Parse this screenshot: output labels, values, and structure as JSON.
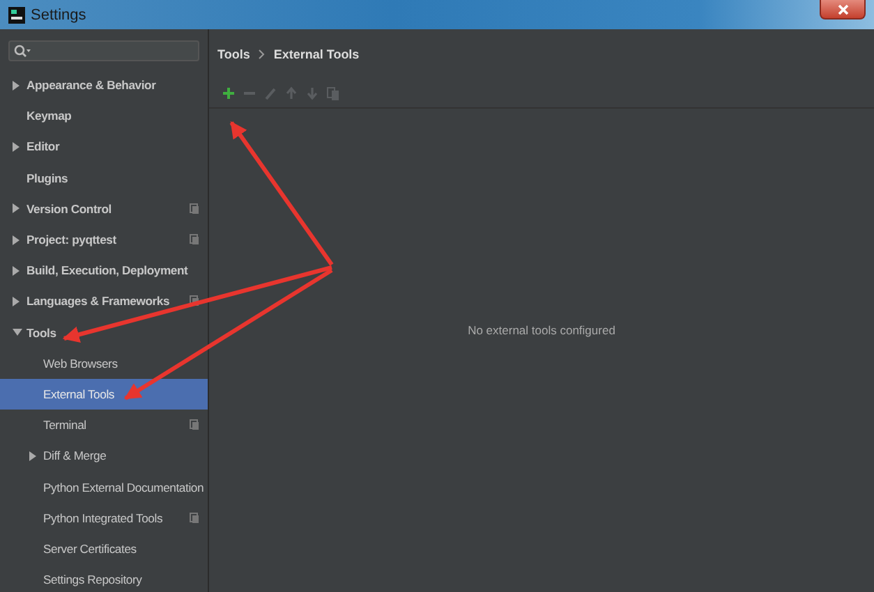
{
  "window": {
    "title": "Settings"
  },
  "breadcrumb": [
    "Tools",
    "External Tools"
  ],
  "tree": [
    {
      "label": "Appearance & Behavior",
      "kind": "group",
      "expanded": false,
      "selected": false,
      "project_icon": false
    },
    {
      "label": "Keymap",
      "kind": "leaf",
      "selected": false,
      "project_icon": false
    },
    {
      "label": "Editor",
      "kind": "group",
      "expanded": false,
      "selected": false,
      "project_icon": false
    },
    {
      "label": "Plugins",
      "kind": "leaf",
      "selected": false,
      "project_icon": false
    },
    {
      "label": "Version Control",
      "kind": "group",
      "expanded": false,
      "selected": false,
      "project_icon": true
    },
    {
      "label": "Project: pyqttest",
      "kind": "group",
      "expanded": false,
      "selected": false,
      "project_icon": true
    },
    {
      "label": "Build, Execution, Deployment",
      "kind": "group",
      "expanded": false,
      "selected": false,
      "project_icon": false
    },
    {
      "label": "Languages & Frameworks",
      "kind": "group",
      "expanded": false,
      "selected": false,
      "project_icon": true
    },
    {
      "label": "Tools",
      "kind": "group",
      "expanded": true,
      "selected": false,
      "project_icon": false,
      "children": [
        {
          "label": "Web Browsers",
          "kind": "leaf",
          "selected": false,
          "project_icon": false
        },
        {
          "label": "External Tools",
          "kind": "leaf",
          "selected": true,
          "project_icon": false
        },
        {
          "label": "Terminal",
          "kind": "leaf",
          "selected": false,
          "project_icon": true
        },
        {
          "label": "Diff & Merge",
          "kind": "group",
          "expanded": false,
          "selected": false,
          "project_icon": false
        },
        {
          "label": "Python External Documentation",
          "kind": "leaf",
          "selected": false,
          "project_icon": false
        },
        {
          "label": "Python Integrated Tools",
          "kind": "leaf",
          "selected": false,
          "project_icon": true
        },
        {
          "label": "Server Certificates",
          "kind": "leaf",
          "selected": false,
          "project_icon": false
        },
        {
          "label": "Settings Repository",
          "kind": "leaf",
          "selected": false,
          "project_icon": false
        }
      ]
    }
  ],
  "toolbar": [
    {
      "kind": "add",
      "disabled": false
    },
    {
      "kind": "remove",
      "disabled": true
    },
    {
      "kind": "edit",
      "disabled": true
    },
    {
      "kind": "up",
      "disabled": true
    },
    {
      "kind": "down",
      "disabled": true
    },
    {
      "kind": "copy",
      "disabled": true
    }
  ],
  "empty_message": "No external tools configured"
}
